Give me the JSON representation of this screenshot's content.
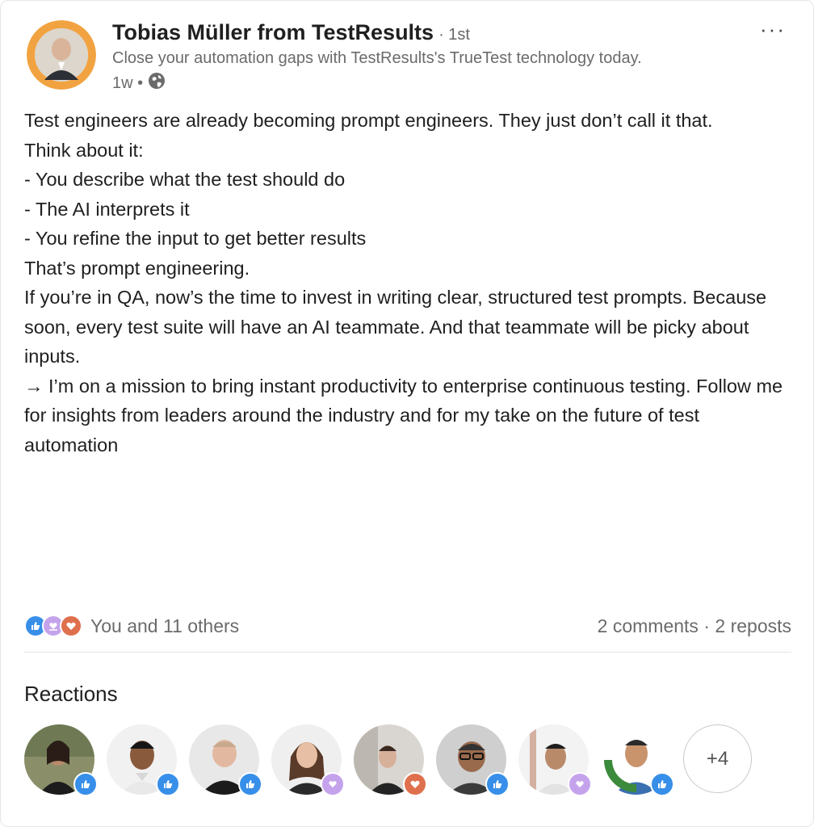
{
  "post": {
    "author_name": "Tobias Müller from TestResults",
    "degree": "· 1st",
    "headline": "Close your automation gaps with TestResults's TrueTest technology today.",
    "time": "1w •",
    "visibility_icon": "globe-icon",
    "more_label": "···",
    "body": [
      "Test engineers are already becoming prompt engineers. They just don’t call it that.",
      "",
      "Think about it:",
      "- You describe what the test should do",
      "- The AI interprets it",
      "- You refine the input to get better results",
      "",
      "That’s prompt engineering.",
      "",
      "If you’re in QA, now’s the time to invest in writing clear, structured test prompts. Because soon, every test suite will have an AI teammate. And that teammate will be picky about inputs.",
      "",
      "→ I’m on a mission to bring instant productivity to enterprise continuous testing. Follow me for insights from leaders around the industry and for my take on the future of test automation"
    ]
  },
  "social": {
    "reaction_icons": [
      "like-icon",
      "support-icon",
      "love-icon"
    ],
    "reactions_text": "You and 11 others",
    "comments": "2 comments",
    "separator": " · ",
    "reposts": "2 reposts"
  },
  "reactions": {
    "title": "Reactions",
    "more": "+4",
    "people": [
      {
        "reaction": "like"
      },
      {
        "reaction": "like"
      },
      {
        "reaction": "like"
      },
      {
        "reaction": "support"
      },
      {
        "reaction": "love"
      },
      {
        "reaction": "like"
      },
      {
        "reaction": "support"
      },
      {
        "reaction": "like"
      }
    ]
  },
  "colors": {
    "like": "#378fe9",
    "support": "#c5a3ec",
    "love": "#df704d",
    "author_avatar_ring": "#f2a341"
  }
}
